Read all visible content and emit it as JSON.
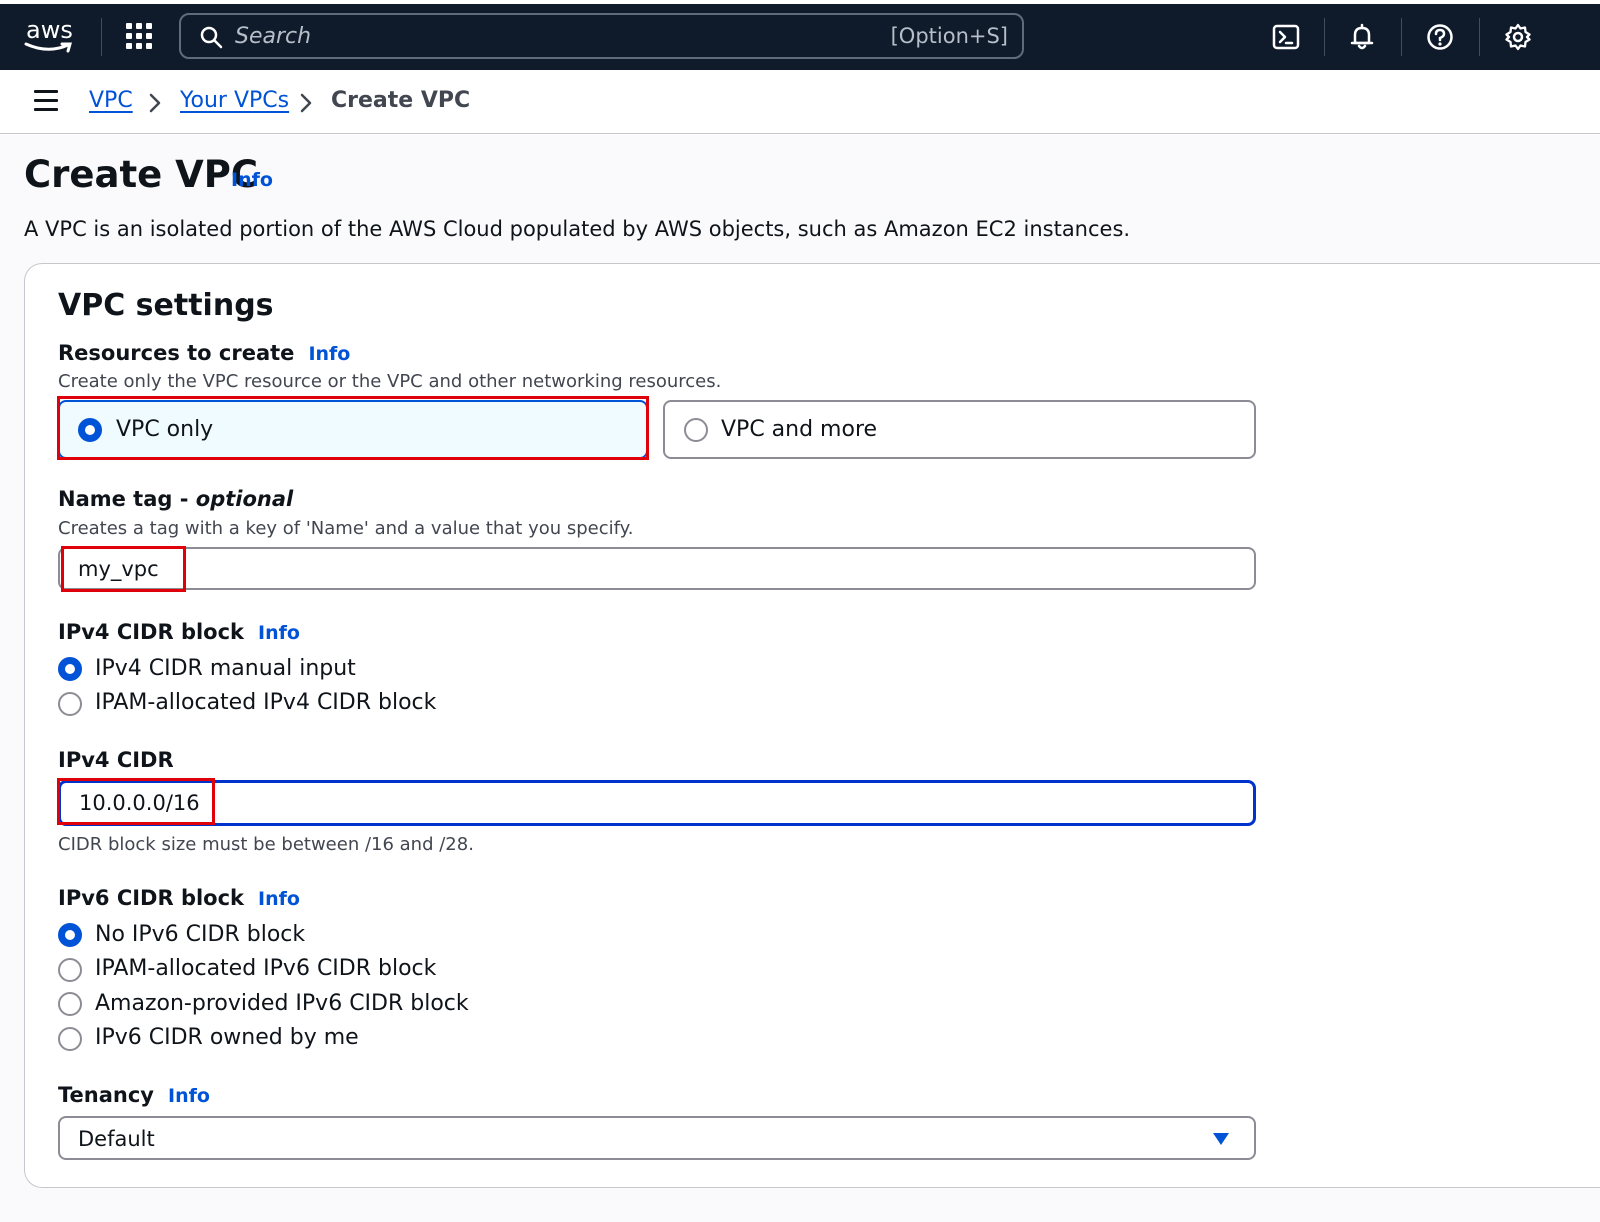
{
  "topnav": {
    "logo_text": "aws",
    "search": {
      "placeholder": "Search",
      "shortcut": "[Option+S]"
    },
    "icons": [
      "cloudshell-icon",
      "bell-icon",
      "help-icon",
      "gear-icon"
    ]
  },
  "breadcrumb": {
    "items": [
      {
        "label": "VPC"
      },
      {
        "label": "Your VPCs"
      },
      {
        "label": "Create VPC"
      }
    ]
  },
  "page": {
    "title": "Create VPC",
    "info": "Info",
    "description": "A VPC is an isolated portion of the AWS Cloud populated by AWS objects, such as Amazon EC2 instances."
  },
  "vpc_settings": {
    "title": "VPC settings",
    "resources": {
      "label": "Resources to create",
      "info": "Info",
      "description": "Create only the VPC resource or the VPC and other networking resources.",
      "options": [
        {
          "label": "VPC only",
          "selected": true
        },
        {
          "label": "VPC and more",
          "selected": false
        }
      ]
    },
    "name_tag": {
      "label": "Name tag",
      "optional": "optional",
      "dash": " - ",
      "description": "Creates a tag with a key of 'Name' and a value that you specify.",
      "value": "my_vpc"
    },
    "ipv4_block": {
      "label": "IPv4 CIDR block",
      "info": "Info",
      "options": [
        {
          "label": "IPv4 CIDR manual input",
          "selected": true
        },
        {
          "label": "IPAM-allocated IPv4 CIDR block",
          "selected": false
        }
      ]
    },
    "ipv4_cidr": {
      "label": "IPv4 CIDR",
      "value": "10.0.0.0/16",
      "constraint": "CIDR block size must be between /16 and /28."
    },
    "ipv6_block": {
      "label": "IPv6 CIDR block",
      "info": "Info",
      "options": [
        {
          "label": "No IPv6 CIDR block",
          "selected": true
        },
        {
          "label": "IPAM-allocated IPv6 CIDR block",
          "selected": false
        },
        {
          "label": "Amazon-provided IPv6 CIDR block",
          "selected": false
        },
        {
          "label": "IPv6 CIDR owned by me",
          "selected": false
        }
      ]
    },
    "tenancy": {
      "label": "Tenancy",
      "info": "Info",
      "value": "Default"
    }
  },
  "colors": {
    "nav_bg": "#0f1b2a",
    "link": "#0052d6",
    "selected": "#0052d6",
    "highlight": "#e0000a"
  }
}
